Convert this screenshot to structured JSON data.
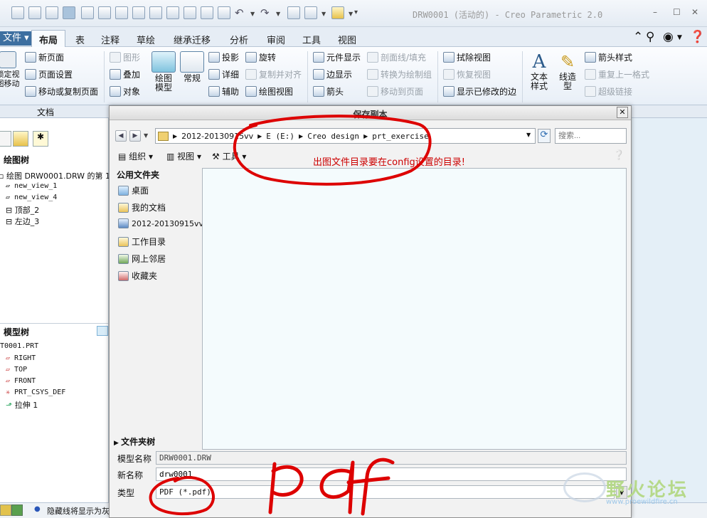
{
  "window": {
    "title": "DRW0001 (活动的) - Creo Parametric 2.0"
  },
  "tabs": [
    {
      "label": "文件"
    },
    {
      "label": "布局"
    },
    {
      "label": "表"
    },
    {
      "label": "注释"
    },
    {
      "label": "草绘"
    },
    {
      "label": "继承迁移"
    },
    {
      "label": "分析"
    },
    {
      "label": "审阅"
    },
    {
      "label": "工具"
    },
    {
      "label": "视图"
    }
  ],
  "ribbon": {
    "lock_label": "锁定视图移动",
    "new_page": "新页面",
    "page_setup": "页面设置",
    "move_copy_pages": "移动或复制页面",
    "graph": "图形",
    "overlay": "叠加",
    "object": "对象",
    "drawing_model": "绘图模型",
    "general": "常规",
    "projection": "投影",
    "detail": "详细",
    "auxiliary": "辅助",
    "rotate": "旋转",
    "copy_align": "复制并对齐",
    "drawing_view": "绘图视图",
    "element_display": "元件显示",
    "edge_display": "边显示",
    "arrow": "箭头",
    "section_fill": "剖面线/填充",
    "convert_to_drawing": "转换为绘制组",
    "move_to_page": "移动到页面",
    "erase_view": "拭除视图",
    "restore_view": "恢复视图",
    "show_modified_edges": "显示已修改的边",
    "text_style": "文本样式",
    "line_style": "线造型",
    "arrow_style": "箭头样式",
    "repeat_format": "重复上一格式",
    "hyperlink": "超级链接",
    "group_document": "文档"
  },
  "left_panel": {
    "drawing_tree_title": "绘图树",
    "drawing_items": [
      "绘图 DRW0001.DRW 的第 1",
      "new_view_1",
      "new_view_4",
      "顶部_2",
      "左边_3"
    ],
    "model_tree_title": "模型树",
    "model_items": [
      "T0001.PRT",
      "RIGHT",
      "TOP",
      "FRONT",
      "PRT_CSYS_DEF",
      "拉伸 1"
    ]
  },
  "dialog": {
    "title": "保存副本",
    "path": [
      "2012-20130915vv",
      "E (E:)",
      "Creo design",
      "prt_exercise"
    ],
    "search_placeholder": "搜索...",
    "organize": "组织",
    "views": "视图",
    "tools": "工具",
    "annotation": "出图文件目录要在config设置的目录!",
    "common_folders_title": "公用文件夹",
    "common_folders": [
      "桌面",
      "我的文档",
      "2012-20130915vv",
      "工作目录",
      "网上邻居",
      "收藏夹"
    ],
    "folder_tree": "文件夹树",
    "model_name_label": "模型名称",
    "model_name_value": "DRW0001.DRW",
    "new_name_label": "新名称",
    "new_name_value": "drw0001",
    "type_label": "类型",
    "type_value": "PDF (*.pdf)"
  },
  "status": {
    "message": "隐藏线将显示为灰"
  },
  "watermark": {
    "text": "野火论坛",
    "url": "www.proewildfire.cn"
  },
  "colors": {
    "annotation_red": "#dd0000",
    "ribbon_blue": "#5f86a8"
  }
}
